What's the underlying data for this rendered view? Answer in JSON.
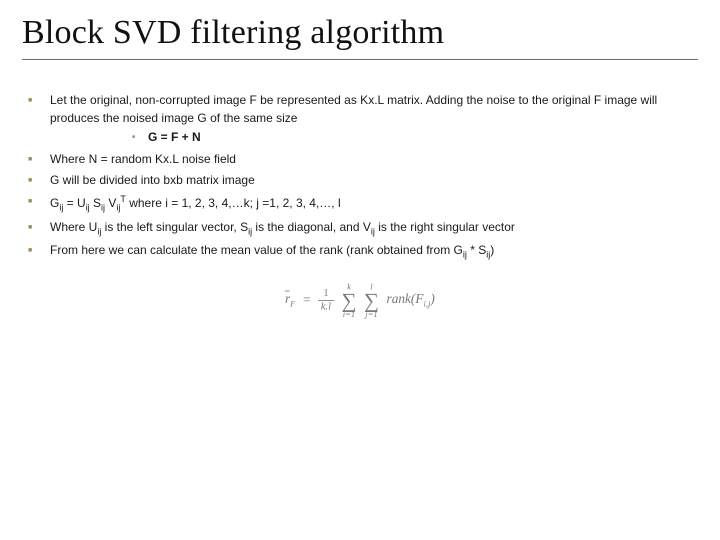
{
  "title": "Block SVD filtering algorithm",
  "bullets": [
    {
      "text": "Let the original, non-corrupted image F be represented as Kx.L matrix. Adding the noise to the original F image will produces the noised image G of the same size",
      "sub": [
        "G = F + N"
      ]
    },
    {
      "text": "Where N = random Kx.L noise field"
    },
    {
      "text": "G will be divided into bxb matrix image"
    },
    {
      "text_html": "G<sub class=\"sub\">ij</sub> = U<sub class=\"sub\">ij</sub> S<sub class=\"sub\">ij</sub> V<sub class=\"sub\">ij</sub><sup class=\"sup\">T</sup> where i = 1, 2, 3, 4,…k; j =1, 2, 3, 4,…, l"
    },
    {
      "text_html": "Where U<sub class=\"sub\">ij</sub> is the left singular vector, S<sub class=\"sub\">ij</sub> is the diagonal, and V<sub class=\"sub\">ij</sub> is the right singular vector"
    },
    {
      "text_html": "From here we can calculate the mean value of the rank (rank obtained from G<sub class=\"sub\">ij</sub> * S<sub class=\"sub\">ij</sub>)"
    }
  ],
  "formula": {
    "lhs_var": "r",
    "lhs_sub": "F",
    "eq": "=",
    "frac_num": "1",
    "frac_den": "k.l",
    "sum1_top": "k",
    "sum1_bot": "i=1",
    "sum2_top": "l",
    "sum2_bot": "j=1",
    "rhs_func": "rank",
    "rhs_arg_var": "F",
    "rhs_arg_sub": "i,j"
  }
}
